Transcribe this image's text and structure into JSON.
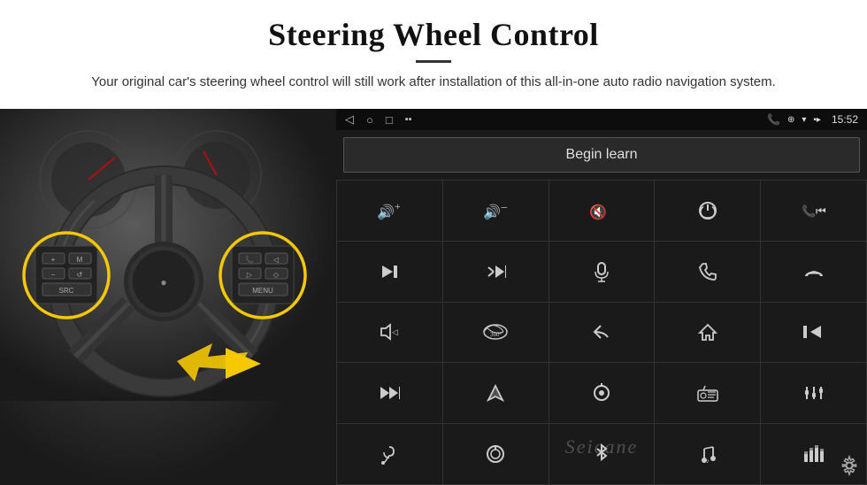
{
  "header": {
    "title": "Steering Wheel Control",
    "subtitle": "Your original car's steering wheel control will still work after installation of this all-in-one auto radio navigation system."
  },
  "status_bar": {
    "nav_back": "◁",
    "nav_home_circle": "○",
    "nav_square": "□",
    "nav_menu": "▪▪",
    "right_icons": "📞 ⊕ ▾",
    "time": "15:52"
  },
  "begin_learn": {
    "label": "Begin learn"
  },
  "controls": [
    {
      "icon": "🔊+",
      "label": "vol-up"
    },
    {
      "icon": "🔊−",
      "label": "vol-down"
    },
    {
      "icon": "🔇",
      "label": "mute"
    },
    {
      "icon": "⏻",
      "label": "power"
    },
    {
      "icon": "📞⏮",
      "label": "phone-prev"
    },
    {
      "icon": "⏭",
      "label": "next-track"
    },
    {
      "icon": "✂⏭",
      "label": "ff"
    },
    {
      "icon": "🎤",
      "label": "mic"
    },
    {
      "icon": "📞",
      "label": "call"
    },
    {
      "icon": "↪",
      "label": "hang-up"
    },
    {
      "icon": "📢",
      "label": "speaker"
    },
    {
      "icon": "360°",
      "label": "360"
    },
    {
      "icon": "↩",
      "label": "back"
    },
    {
      "icon": "🏠",
      "label": "home"
    },
    {
      "icon": "⏮⏮",
      "label": "prev-prev"
    },
    {
      "icon": "⏭⏭",
      "label": "fast-forward"
    },
    {
      "icon": "▶",
      "label": "play"
    },
    {
      "icon": "⏺",
      "label": "source"
    },
    {
      "icon": "📻",
      "label": "radio"
    },
    {
      "icon": "⚙⚙",
      "label": "eq"
    },
    {
      "icon": "🎤",
      "label": "mic2"
    },
    {
      "icon": "🎛",
      "label": "knob"
    },
    {
      "icon": "✱",
      "label": "bluetooth"
    },
    {
      "icon": "🎵",
      "label": "music"
    },
    {
      "icon": "📊",
      "label": "equalizer"
    }
  ],
  "watermark": "Seicane",
  "gear_icon": "⚙"
}
